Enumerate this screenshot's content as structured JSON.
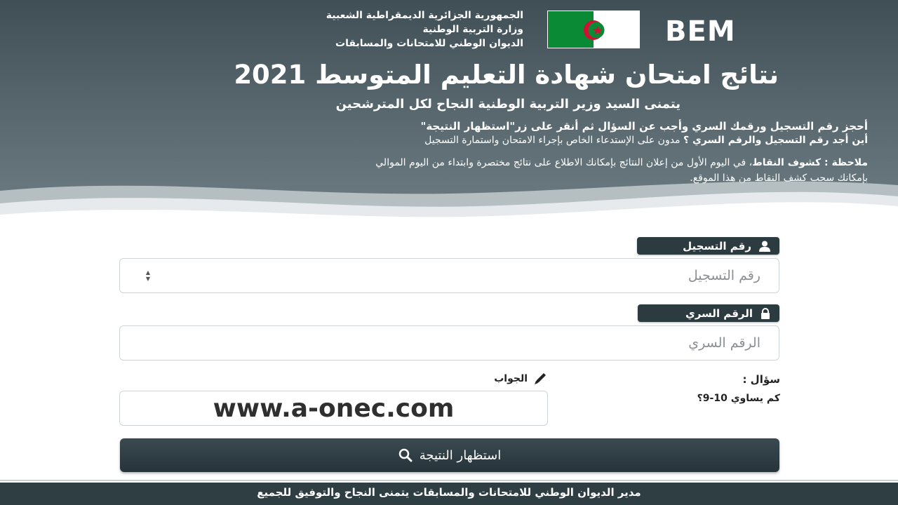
{
  "header": {
    "badge": "BEM",
    "ministry_lines": [
      "الجمهورية الجزائرية الديمقراطية الشعبية",
      "وزارة التربية الوطنية",
      "الديوان الوطني للامتحانات والمسابقات"
    ],
    "title": "نتائج امتحان شهادة التعليم المتوسط 2021",
    "subtitle": "يتمنى السيد وزير التربية الوطنية النجاح لكل المترشحين",
    "instruction_1": "أحجز رقم التسجيل ورقمك السري وأجب عن السؤال ثم أنقر على زر\"استظهار النتيجة\"",
    "instruction_2_bold": "أين أجد رقم التسجيل والرقم السري ؟",
    "instruction_2_rest": " مدون على الإستدعاء الخاص بإجراء الامتحان واستمارة التسجيل",
    "note_bold": "ملاحظة : كشوف النقاط",
    "note_rest": "، في اليوم الأول من إعلان النتائج بإمكانك الاطلاع على نتائج مختصرة وابتداء من اليوم الموالي",
    "note_line_2": "بإمكانك سحب كشف النقاط من هذا الموقع.",
    "colors": {
      "header_bg": "#4f5f65",
      "flag_green": "#0b8a35",
      "flag_red": "#d21034"
    }
  },
  "form": {
    "registration": {
      "label": "رقم التسجيل",
      "placeholder": "رقم التسجيل",
      "value": "",
      "icon": "user-icon"
    },
    "secret": {
      "label": "الرقم السري",
      "placeholder": "الرقم السري",
      "value": "",
      "icon": "lock-icon"
    },
    "question": {
      "label": "سؤال :",
      "text": "كم يساوي 10-9؟"
    },
    "answer": {
      "label": "الجواب",
      "value": "www.a-onec.com",
      "icon": "pencil-icon"
    },
    "submit": {
      "label": "استظهار النتيجة",
      "icon": "search-icon"
    }
  },
  "footer": {
    "text": "مدير الديوان الوطني للامتحانات والمسابقات يتمنى النجاح والتوفيق للجميع"
  }
}
